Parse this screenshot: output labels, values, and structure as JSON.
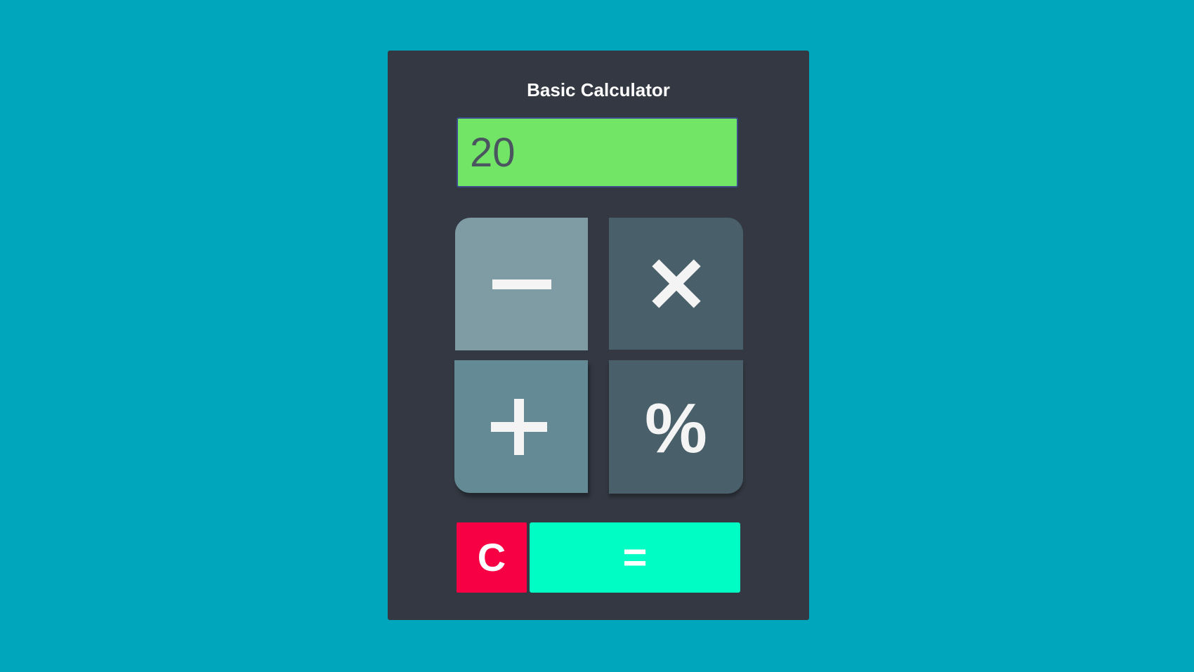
{
  "app": {
    "title": "Basic Calculator"
  },
  "display": {
    "value": "20"
  },
  "operators": [
    {
      "label": "−",
      "icon": "minus-icon",
      "color": "#7f9ca5"
    },
    {
      "label": "×",
      "icon": "times-icon",
      "color": "#495f6a"
    },
    {
      "label": "+",
      "icon": "plus-icon",
      "color": "#648a95"
    },
    {
      "label": "%",
      "icon": "percent-icon",
      "color": "#495f6a"
    }
  ],
  "actions": {
    "clear_label": "C",
    "equals_label": "="
  },
  "colors": {
    "background": "#00a6bb",
    "panel": "#333842",
    "display": "#72e566",
    "clear": "#f70044",
    "equals": "#00fdc3"
  }
}
